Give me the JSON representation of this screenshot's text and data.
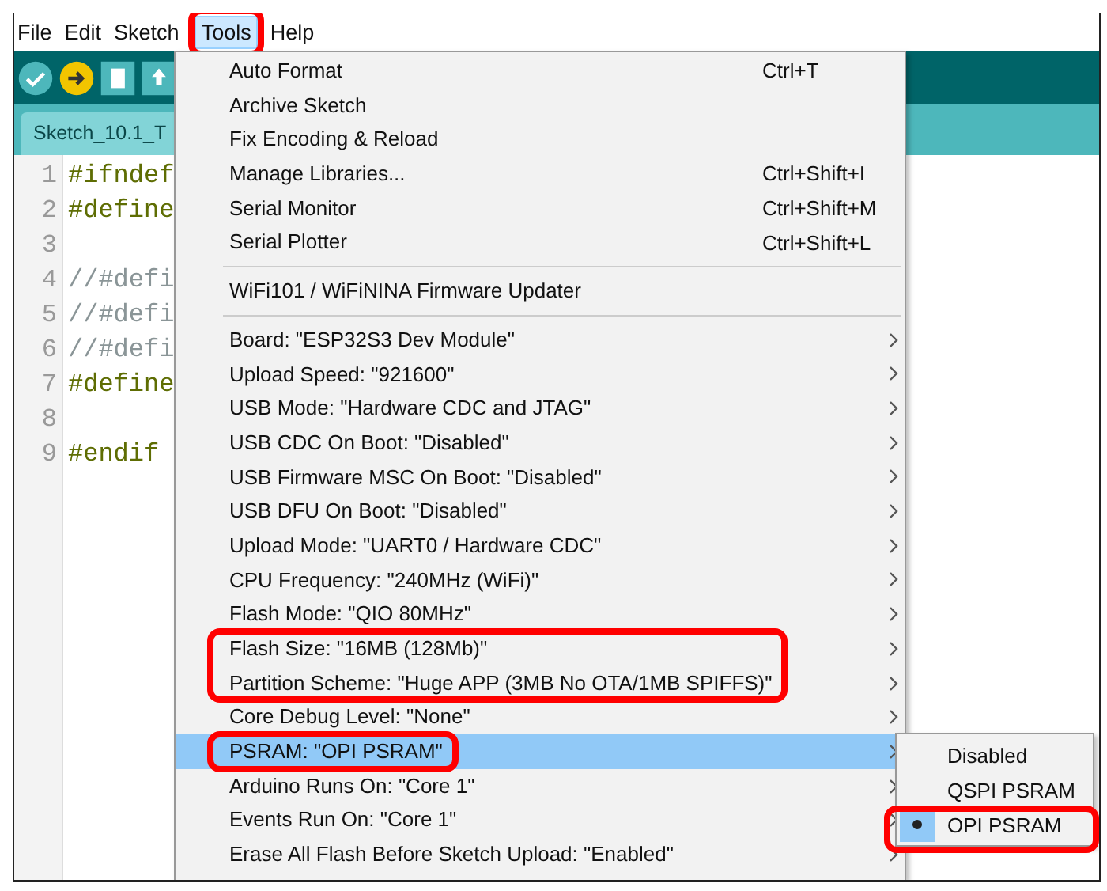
{
  "menubar": [
    {
      "label": "File",
      "selected": false,
      "circled": false
    },
    {
      "label": "Edit",
      "selected": false,
      "circled": false
    },
    {
      "label": "Sketch",
      "selected": false,
      "circled": false
    },
    {
      "label": "Tools",
      "selected": true,
      "circled": true
    },
    {
      "label": "Help",
      "selected": false,
      "circled": false
    }
  ],
  "tab": {
    "label": "Sketch_10.1_T"
  },
  "code": [
    {
      "number": "1",
      "text": "#ifndef",
      "kind": "directive"
    },
    {
      "number": "2",
      "text": "#define",
      "kind": "directive"
    },
    {
      "number": "3",
      "kind": "blank"
    },
    {
      "number": "4",
      "text": "//#defi",
      "kind": "comment"
    },
    {
      "number": "5",
      "text": "//#defi",
      "kind": "comment"
    },
    {
      "number": "6",
      "text": "//#defi",
      "kind": "comment"
    },
    {
      "number": "7",
      "text": "#define",
      "kind": "directive"
    },
    {
      "number": "8",
      "kind": "blank"
    },
    {
      "number": "9",
      "text": "#endif",
      "kind": "directive"
    }
  ],
  "menu": {
    "sections": [
      {
        "items": [
          {
            "label": "Auto Format",
            "shortcut": "Ctrl+T",
            "submenu": false,
            "selected": false,
            "circled": false
          },
          {
            "label": "Archive Sketch",
            "submenu": false,
            "selected": false,
            "circled": false
          },
          {
            "label": "Fix Encoding & Reload",
            "submenu": false,
            "selected": false,
            "circled": false
          },
          {
            "label": "Manage Libraries...",
            "shortcut": "Ctrl+Shift+I",
            "submenu": false,
            "selected": false,
            "circled": false
          },
          {
            "label": "Serial Monitor",
            "shortcut": "Ctrl+Shift+M",
            "submenu": false,
            "selected": false,
            "circled": false
          },
          {
            "label": "Serial Plotter",
            "shortcut": "Ctrl+Shift+L",
            "submenu": false,
            "selected": false,
            "circled": false
          }
        ]
      },
      {
        "items": [
          {
            "label": "WiFi101 / WiFiNINA Firmware Updater",
            "submenu": false,
            "selected": false,
            "circled": false
          }
        ]
      },
      {
        "items": [
          {
            "label": "Board: \"ESP32S3 Dev Module\"",
            "submenu": true,
            "selected": false,
            "circled": false
          },
          {
            "label": "Upload Speed: \"921600\"",
            "submenu": true,
            "selected": false,
            "circled": false
          },
          {
            "label": "USB Mode: \"Hardware CDC and JTAG\"",
            "submenu": true,
            "selected": false,
            "circled": false
          },
          {
            "label": "USB CDC On Boot: \"Disabled\"",
            "submenu": true,
            "selected": false,
            "circled": false
          },
          {
            "label": "USB Firmware MSC On Boot: \"Disabled\"",
            "submenu": true,
            "selected": false,
            "circled": false
          },
          {
            "label": "USB DFU On Boot: \"Disabled\"",
            "submenu": true,
            "selected": false,
            "circled": false
          },
          {
            "label": "Upload Mode: \"UART0 / Hardware CDC\"",
            "submenu": true,
            "selected": false,
            "circled": false
          },
          {
            "label": "CPU Frequency: \"240MHz (WiFi)\"",
            "submenu": true,
            "selected": false,
            "circled": false
          },
          {
            "label": "Flash Mode: \"QIO 80MHz\"",
            "submenu": true,
            "selected": false,
            "circled": false
          },
          {
            "label": "Flash Size: \"16MB (128Mb)\"",
            "submenu": true,
            "selected": false,
            "circled": true
          },
          {
            "label": "Partition Scheme: \"Huge APP (3MB No OTA/1MB SPIFFS)\"",
            "submenu": true,
            "selected": false,
            "circled": true
          },
          {
            "label": "Core Debug Level: \"None\"",
            "submenu": true,
            "selected": false,
            "circled": false
          },
          {
            "label": "PSRAM: \"OPI PSRAM\"",
            "submenu": true,
            "selected": true,
            "circled": true
          },
          {
            "label": "Arduino Runs On: \"Core 1\"",
            "submenu": true,
            "selected": false,
            "circled": false
          },
          {
            "label": "Events Run On: \"Core 1\"",
            "submenu": true,
            "selected": false,
            "circled": false
          },
          {
            "label": "Erase All Flash Before Sketch Upload: \"Enabled\"",
            "submenu": true,
            "selected": false,
            "circled": false
          }
        ]
      }
    ]
  },
  "submenu": {
    "items": [
      {
        "label": "Disabled",
        "selected": false,
        "circled": false
      },
      {
        "label": "QSPI PSRAM",
        "selected": false,
        "circled": false
      },
      {
        "label": "OPI PSRAM",
        "selected": true,
        "circled": true
      }
    ]
  }
}
